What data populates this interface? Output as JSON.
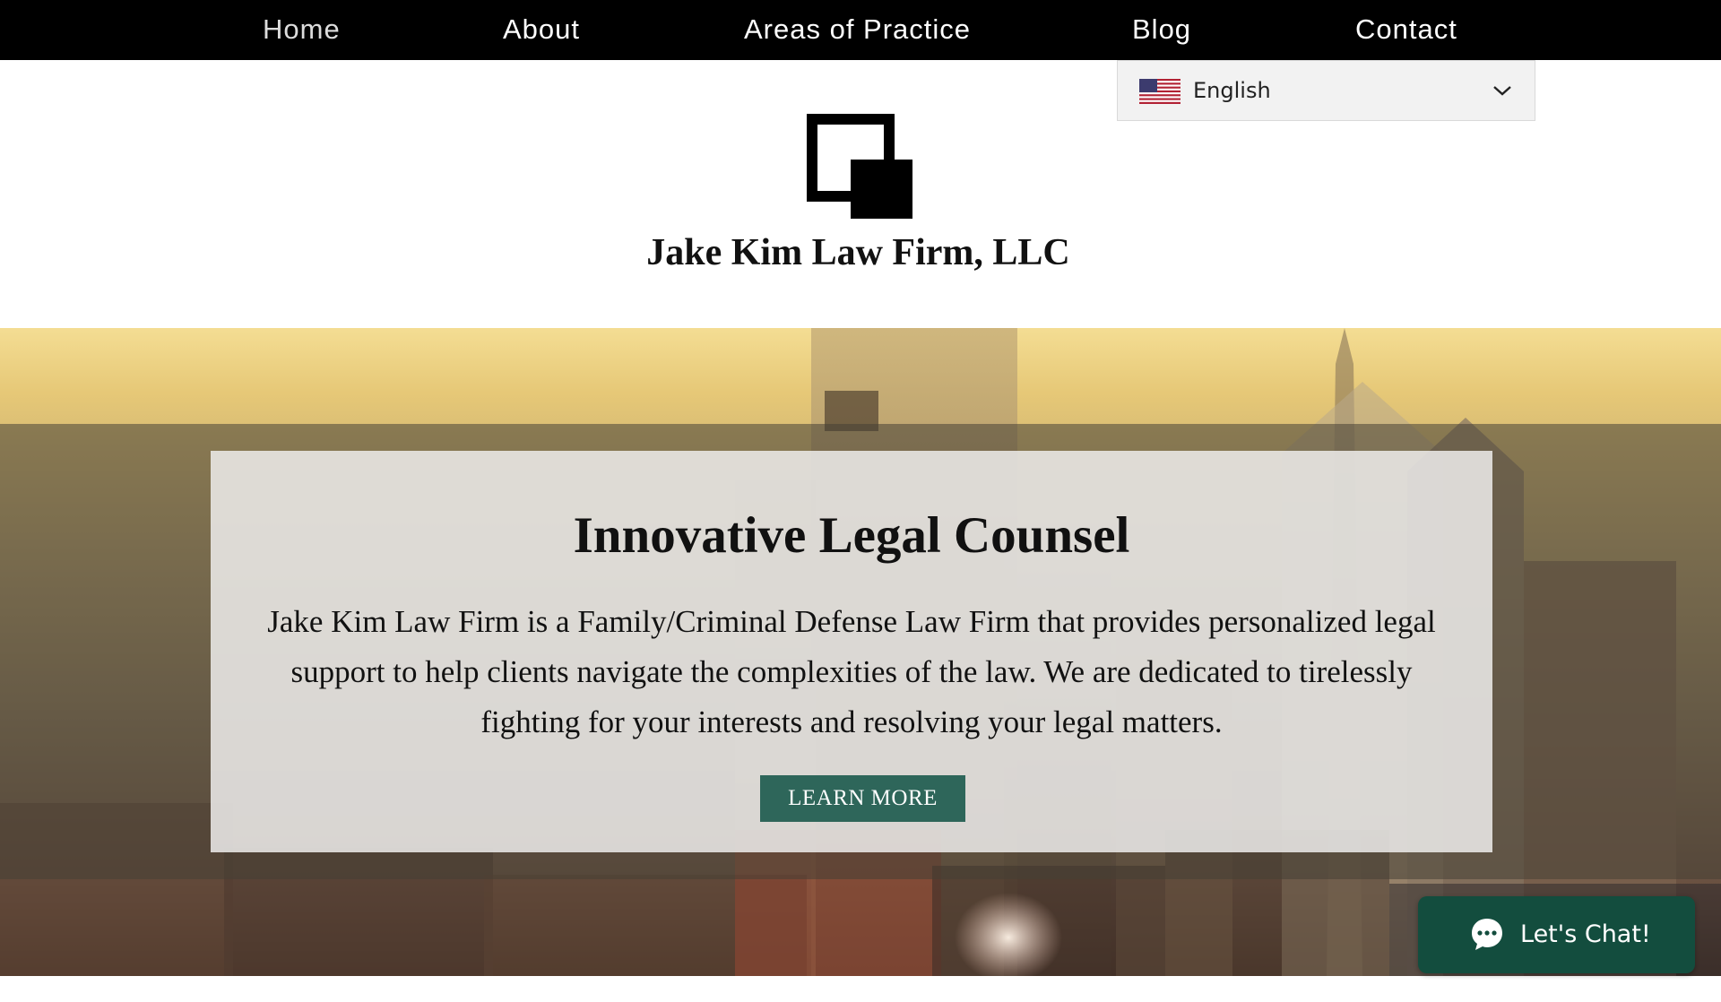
{
  "nav": {
    "items": [
      {
        "label": "Home"
      },
      {
        "label": "About"
      },
      {
        "label": "Areas of Practice"
      },
      {
        "label": "Blog"
      },
      {
        "label": "Contact"
      }
    ]
  },
  "language": {
    "selected": "English",
    "flag_icon": "us-flag-icon"
  },
  "brand": {
    "name": "Jake Kim Law Firm, LLC",
    "logo_icon": "overlapping-squares-logo"
  },
  "hero": {
    "title": "Innovative Legal Counsel",
    "body": "Jake Kim Law Firm is a Family/Criminal Defense Law Firm that provides personalized legal support to help clients navigate the complexities of the law. We are dedicated to tirelessly fighting for your interests and resolving your legal matters.",
    "cta_label": "LEARN MORE"
  },
  "chat": {
    "label": "Let's Chat!",
    "icon": "chat-bubble-icon"
  },
  "colors": {
    "nav_bg": "#000000",
    "cta_bg": "#2e665a",
    "chat_bg": "#134d3e"
  }
}
